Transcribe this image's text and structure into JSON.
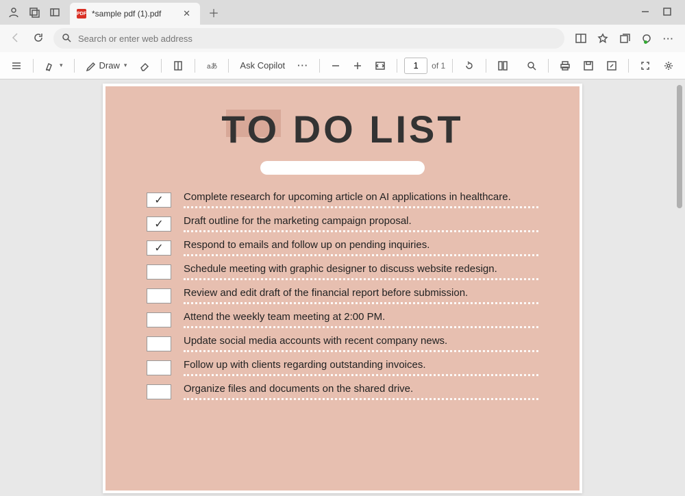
{
  "titlebar": {
    "tab_title": "*sample pdf (1).pdf"
  },
  "addressbar": {
    "placeholder": "Search or enter web address"
  },
  "pdftoolbar": {
    "draw_label": "Draw",
    "copilot_label": "Ask Copilot",
    "page_current": "1",
    "page_total_label": "of 1"
  },
  "document": {
    "title": "TO DO LIST",
    "items": [
      {
        "checked": true,
        "text": "Complete research for upcoming article on AI applications in healthcare."
      },
      {
        "checked": true,
        "text": "Draft outline for the marketing campaign proposal."
      },
      {
        "checked": true,
        "text": "Respond to emails and follow up on pending inquiries."
      },
      {
        "checked": false,
        "text": "Schedule meeting with graphic designer to discuss website redesign."
      },
      {
        "checked": false,
        "text": "Review and edit draft of the financial report before submission."
      },
      {
        "checked": false,
        "text": "Attend the weekly team meeting at 2:00 PM."
      },
      {
        "checked": false,
        "text": "Update social media accounts with recent company news."
      },
      {
        "checked": false,
        "text": "Follow up with clients regarding outstanding invoices."
      },
      {
        "checked": false,
        "text": "Organize files and documents on the shared drive."
      }
    ]
  }
}
